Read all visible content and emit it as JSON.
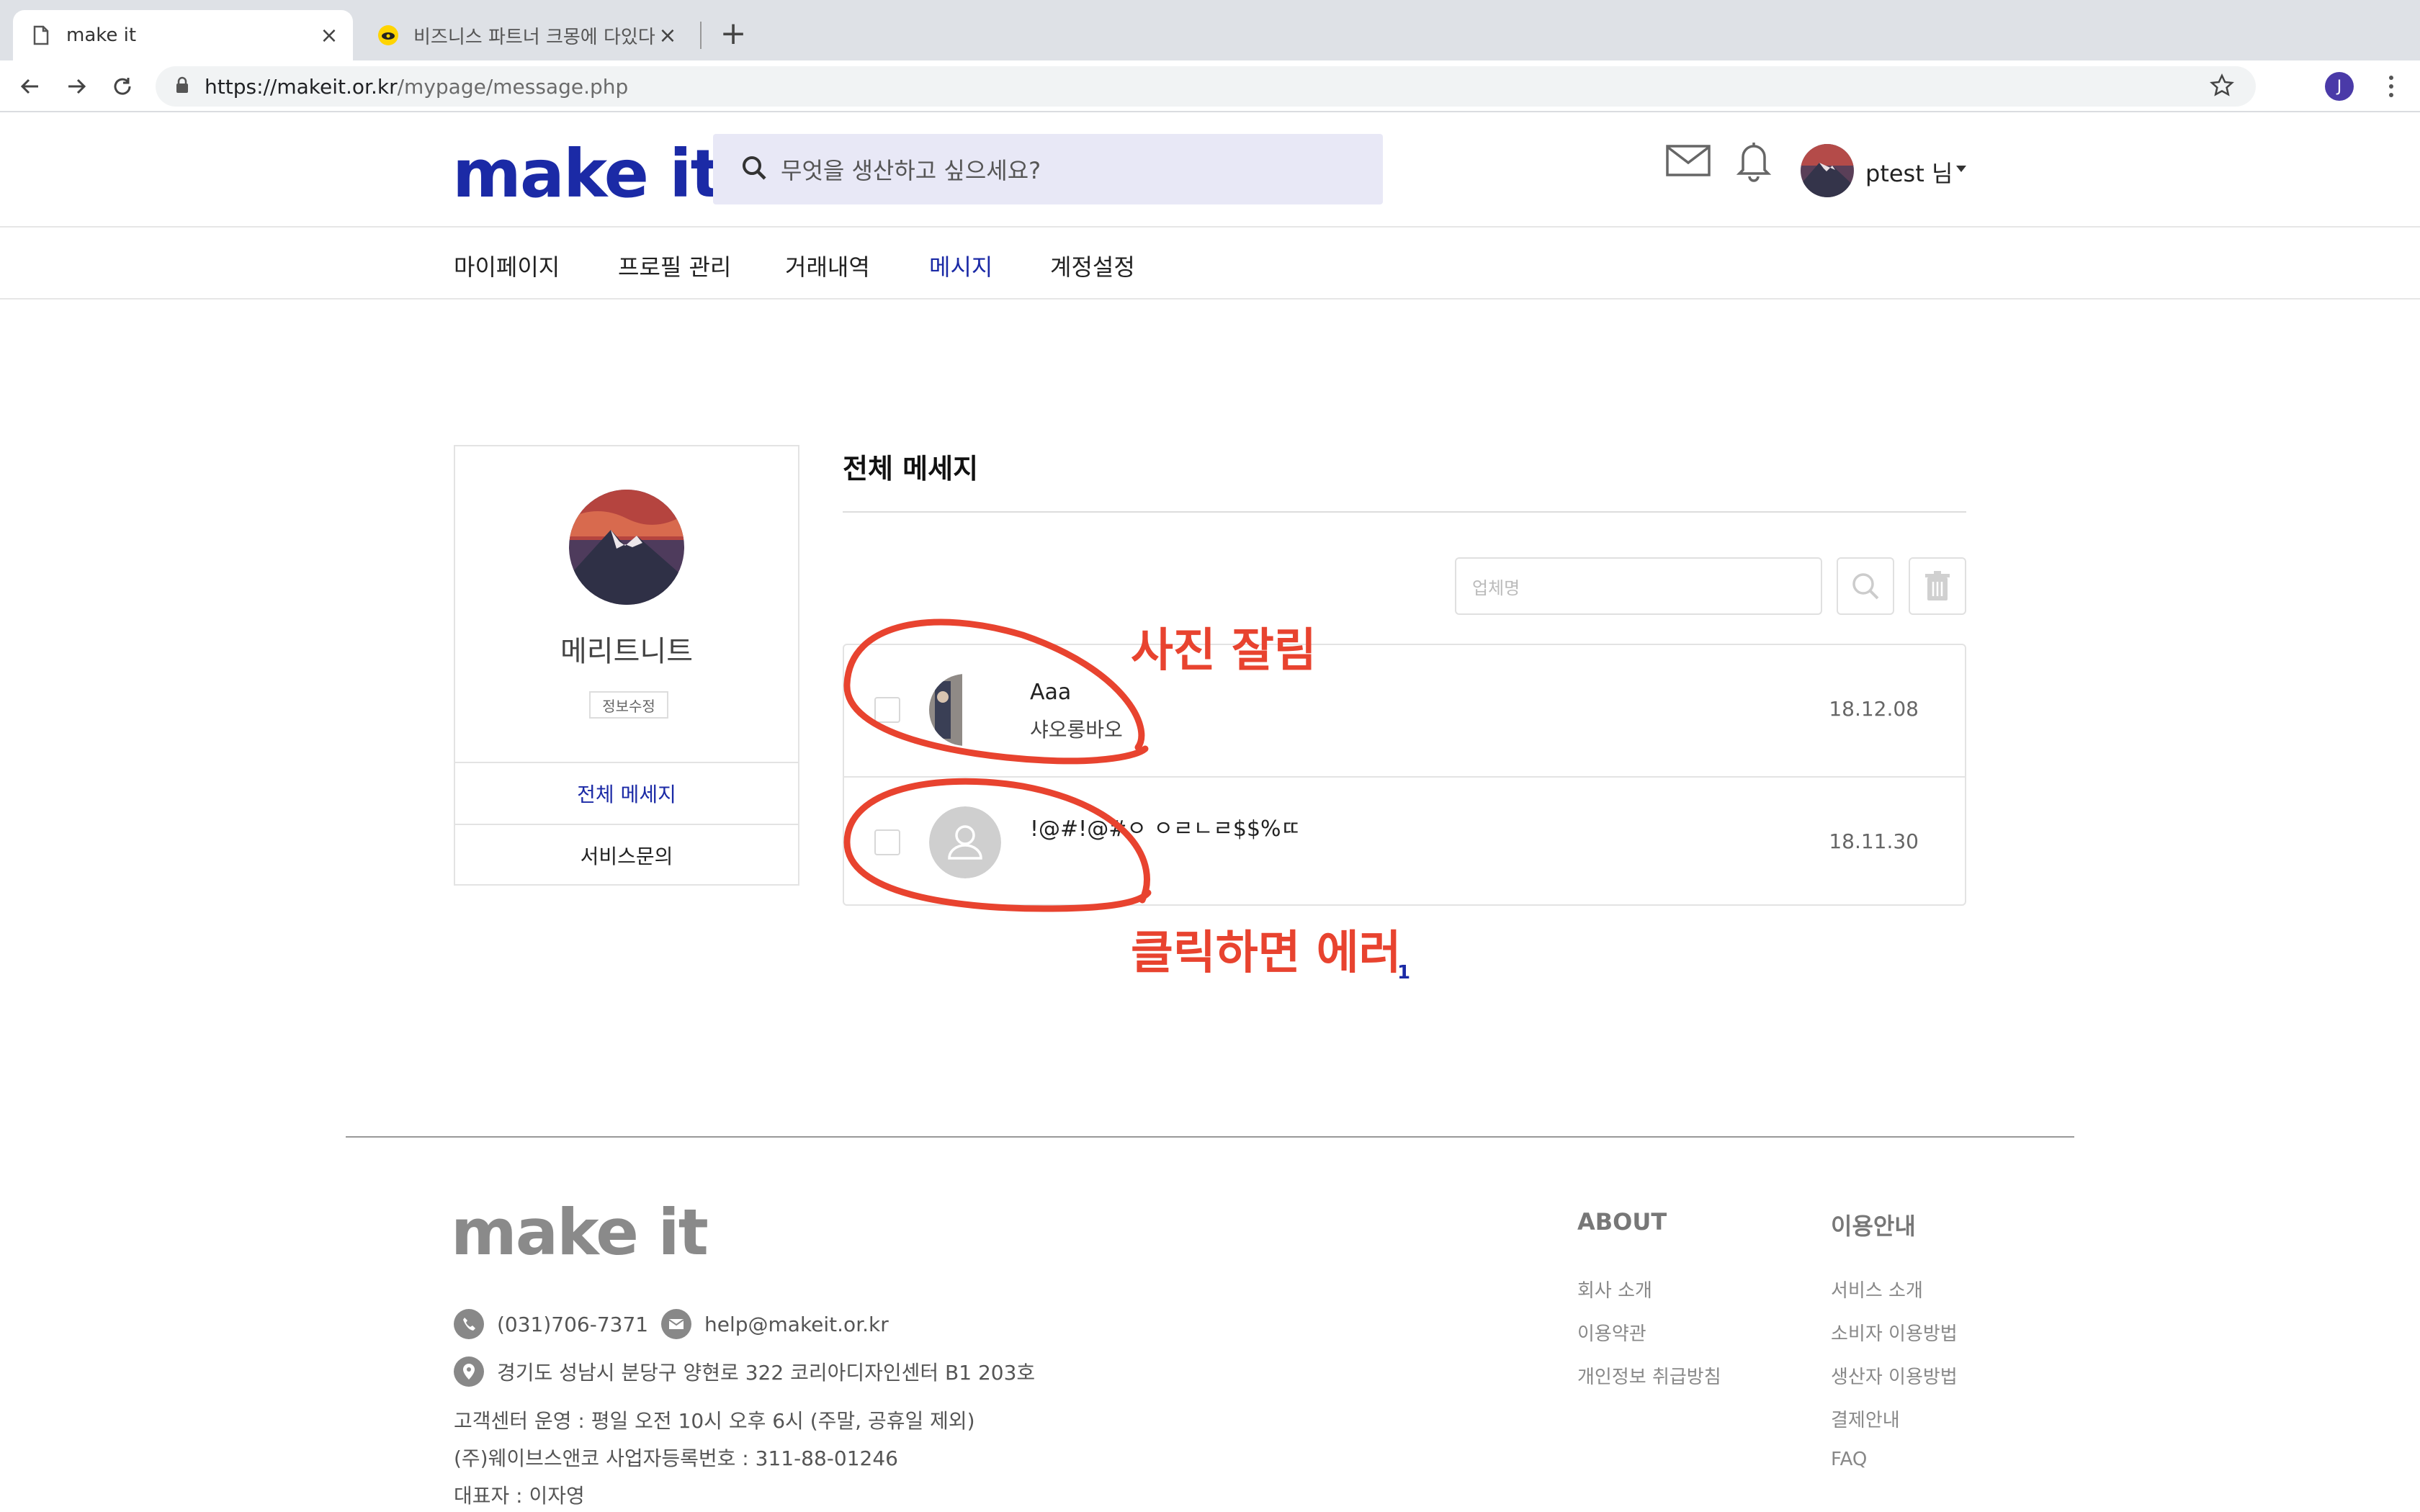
{
  "browser": {
    "tabs": [
      {
        "title": "make it",
        "active": true
      },
      {
        "title": "비즈니스 파트너 크몽에 다있다! 외주",
        "active": false
      }
    ],
    "url_host": "https://makeit.or.kr",
    "url_path": "/mypage/message.php",
    "profile_initial": "J"
  },
  "site": {
    "logo": "make it",
    "search_placeholder": "무엇을 생산하고 싶으세요?",
    "user_label": "ptest 님"
  },
  "subnav": [
    "마이페이지",
    "프로필 관리",
    "거래내역",
    "메시지",
    "계정설정"
  ],
  "subnav_active": "메시지",
  "sidebar": {
    "name": "메리트니트",
    "edit_label": "정보수정",
    "menu": [
      "전체 메세지",
      "서비스문의"
    ],
    "active": "전체 메세지"
  },
  "main": {
    "title": "전체 메세지",
    "filter_placeholder": "업체명",
    "messages": [
      {
        "sender": "Aaa",
        "preview": "샤오롱바오",
        "date": "18.12.08"
      },
      {
        "sender": "!@#!@#ㅇ ㅇㄹㄴㄹ$$%ㄸ",
        "preview": "",
        "date": "18.11.30"
      }
    ]
  },
  "annotations": {
    "note_photo": "사진 잘림",
    "note_error": "클릭하면 에러",
    "marker": "1"
  },
  "footer": {
    "logo": "make it",
    "phone": "(031)706-7371",
    "email": "help@makeit.or.kr",
    "address": "경기도 성남시 분당구 양현로 322 코리아디자인센터 B1 203호",
    "hours": "고객센터 운영 : 평일 오전 10시 오후 6시 (주말, 공휴일 제외)",
    "biz_no": "(주)웨이브스앤코 사업자등록번호 : 311-88-01246",
    "ceo": "대표자 : 이자영",
    "about_title": "ABOUT",
    "about_links": [
      "회사 소개",
      "이용약관",
      "개인정보 취급방침"
    ],
    "guide_title": "이용안내",
    "guide_links": [
      "서비스 소개",
      "소비자 이용방법",
      "생산자 이용방법",
      "결제안내",
      "FAQ"
    ]
  },
  "colors": {
    "brand": "#1b2aa6",
    "annotation": "#e8432f"
  }
}
